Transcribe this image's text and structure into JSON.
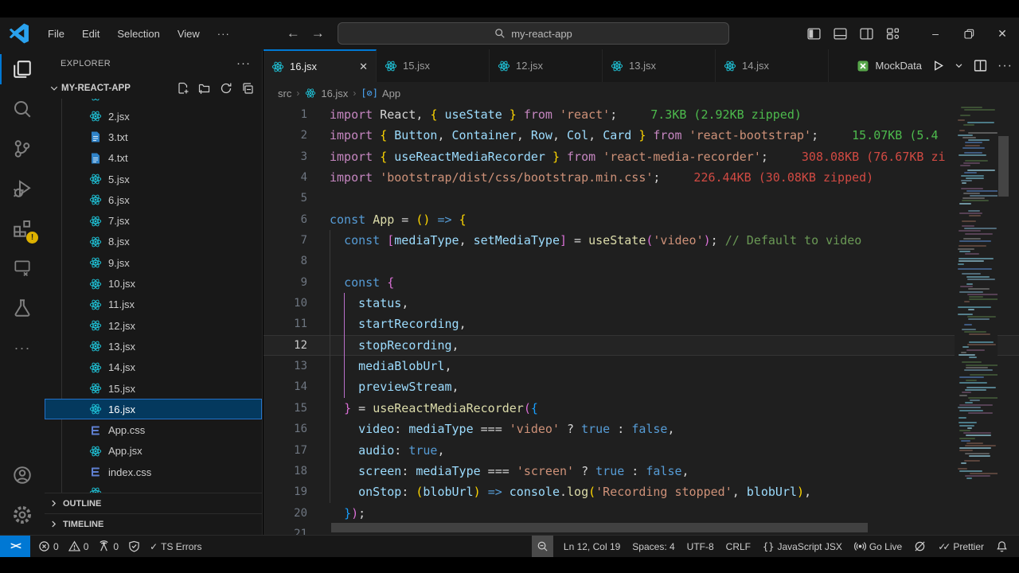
{
  "title_bar": {
    "menus": [
      "File",
      "Edit",
      "Selection",
      "View"
    ],
    "menu_more": "···",
    "search_value": "my-react-app"
  },
  "activity_bar": {
    "items": [
      {
        "icon": "files-icon",
        "active": true
      },
      {
        "icon": "search-icon"
      },
      {
        "icon": "source-control-icon"
      },
      {
        "icon": "run-debug-icon"
      },
      {
        "icon": "extensions-icon",
        "badge": "!"
      },
      {
        "icon": "remote-explorer-icon"
      },
      {
        "icon": "test-beaker-icon"
      },
      {
        "icon": "more-icon"
      }
    ],
    "bottom": [
      {
        "icon": "account-icon"
      },
      {
        "icon": "settings-gear-icon"
      }
    ]
  },
  "explorer": {
    "header": "EXPLORER",
    "header_more": "···",
    "section": "MY-REACT-APP",
    "files": [
      {
        "name": "2.jsx",
        "type": "jsx"
      },
      {
        "name": "3.txt",
        "type": "txt"
      },
      {
        "name": "4.txt",
        "type": "txt"
      },
      {
        "name": "5.jsx",
        "type": "jsx"
      },
      {
        "name": "6.jsx",
        "type": "jsx"
      },
      {
        "name": "7.jsx",
        "type": "jsx"
      },
      {
        "name": "8.jsx",
        "type": "jsx"
      },
      {
        "name": "9.jsx",
        "type": "jsx"
      },
      {
        "name": "10.jsx",
        "type": "jsx"
      },
      {
        "name": "11.jsx",
        "type": "jsx"
      },
      {
        "name": "12.jsx",
        "type": "jsx"
      },
      {
        "name": "13.jsx",
        "type": "jsx"
      },
      {
        "name": "14.jsx",
        "type": "jsx"
      },
      {
        "name": "15.jsx",
        "type": "jsx"
      },
      {
        "name": "16.jsx",
        "type": "jsx",
        "selected": true
      },
      {
        "name": "App.css",
        "type": "css"
      },
      {
        "name": "App.jsx",
        "type": "jsx"
      },
      {
        "name": "index.css",
        "type": "css"
      }
    ],
    "panels": [
      "OUTLINE",
      "TIMELINE"
    ]
  },
  "tabs": [
    {
      "label": "16.jsx",
      "active": true
    },
    {
      "label": "15.jsx"
    },
    {
      "label": "12.jsx"
    },
    {
      "label": "13.jsx"
    },
    {
      "label": "14.jsx"
    }
  ],
  "editor_actions": {
    "run_config": "MockData"
  },
  "breadcrumb": {
    "folder": "src",
    "file": "16.jsx",
    "symbol": "App"
  },
  "code": {
    "lines": [
      {
        "num": 1,
        "tokens": [
          [
            "kw",
            "import"
          ],
          [
            "pun",
            " "
          ],
          [
            "pun",
            "React"
          ],
          [
            "pun",
            ", "
          ],
          [
            "b1",
            "{"
          ],
          [
            "var",
            " useState "
          ],
          [
            "b1",
            "}"
          ],
          [
            "pun",
            " "
          ],
          [
            "kw",
            "from"
          ],
          [
            "pun",
            " "
          ],
          [
            "str",
            "'react'"
          ],
          [
            "pun",
            ";"
          ]
        ],
        "annotation": {
          "text": "7.3KB (2.92KB zipped)",
          "kind": "ok"
        }
      },
      {
        "num": 2,
        "tokens": [
          [
            "kw",
            "import"
          ],
          [
            "pun",
            " "
          ],
          [
            "b1",
            "{"
          ],
          [
            "var",
            " Button"
          ],
          [
            "pun",
            ", "
          ],
          [
            "var",
            "Container"
          ],
          [
            "pun",
            ", "
          ],
          [
            "var",
            "Row"
          ],
          [
            "pun",
            ", "
          ],
          [
            "var",
            "Col"
          ],
          [
            "pun",
            ", "
          ],
          [
            "var",
            "Card"
          ],
          [
            "pun",
            " "
          ],
          [
            "b1",
            "}"
          ],
          [
            "pun",
            " "
          ],
          [
            "kw",
            "from"
          ],
          [
            "pun",
            " "
          ],
          [
            "str",
            "'react-bootstrap'"
          ],
          [
            "pun",
            ";"
          ]
        ],
        "annotation": {
          "text": "15.07KB (5.4",
          "kind": "ok"
        }
      },
      {
        "num": 3,
        "tokens": [
          [
            "kw",
            "import"
          ],
          [
            "pun",
            " "
          ],
          [
            "b1",
            "{"
          ],
          [
            "var",
            " useReactMediaRecorder "
          ],
          [
            "b1",
            "}"
          ],
          [
            "pun",
            " "
          ],
          [
            "kw",
            "from"
          ],
          [
            "pun",
            " "
          ],
          [
            "str",
            "'react-media-recorder'"
          ],
          [
            "pun",
            ";"
          ]
        ],
        "annotation": {
          "text": "308.08KB (76.67KB zi",
          "kind": "err"
        }
      },
      {
        "num": 4,
        "tokens": [
          [
            "kw",
            "import"
          ],
          [
            "pun",
            " "
          ],
          [
            "str",
            "'bootstrap/dist/css/bootstrap.min.css'"
          ],
          [
            "pun",
            ";"
          ]
        ],
        "annotation": {
          "text": "226.44KB (30.08KB zipped)",
          "kind": "err"
        }
      },
      {
        "num": 5,
        "tokens": []
      },
      {
        "num": 6,
        "tokens": [
          [
            "kw2",
            "const"
          ],
          [
            "pun",
            " "
          ],
          [
            "fn",
            "App"
          ],
          [
            "pun",
            " = "
          ],
          [
            "b1",
            "()"
          ],
          [
            "pun",
            " "
          ],
          [
            "kw2",
            "=>"
          ],
          [
            "pun",
            " "
          ],
          [
            "b1",
            "{"
          ]
        ]
      },
      {
        "num": 7,
        "tokens": [
          [
            "pun",
            "  "
          ],
          [
            "kw2",
            "const"
          ],
          [
            "pun",
            " "
          ],
          [
            "b2",
            "["
          ],
          [
            "var",
            "mediaType"
          ],
          [
            "pun",
            ", "
          ],
          [
            "var",
            "setMediaType"
          ],
          [
            "b2",
            "]"
          ],
          [
            "pun",
            " = "
          ],
          [
            "fn",
            "useState"
          ],
          [
            "b2",
            "("
          ],
          [
            "str",
            "'video'"
          ],
          [
            "b2",
            ")"
          ],
          [
            "pun",
            "; "
          ],
          [
            "cm",
            "// Default to video"
          ]
        ]
      },
      {
        "num": 8,
        "tokens": []
      },
      {
        "num": 9,
        "tokens": [
          [
            "pun",
            "  "
          ],
          [
            "kw2",
            "const"
          ],
          [
            "pun",
            " "
          ],
          [
            "b2",
            "{"
          ]
        ]
      },
      {
        "num": 10,
        "tokens": [
          [
            "pun",
            "    "
          ],
          [
            "var",
            "status"
          ],
          [
            "pun",
            ","
          ]
        ]
      },
      {
        "num": 11,
        "tokens": [
          [
            "pun",
            "    "
          ],
          [
            "var",
            "startRecording"
          ],
          [
            "pun",
            ","
          ]
        ]
      },
      {
        "num": 12,
        "current": true,
        "tokens": [
          [
            "pun",
            "    "
          ],
          [
            "var",
            "stopRecording"
          ],
          [
            "pun",
            ","
          ]
        ]
      },
      {
        "num": 13,
        "tokens": [
          [
            "pun",
            "    "
          ],
          [
            "var",
            "mediaBlobUrl"
          ],
          [
            "pun",
            ","
          ]
        ]
      },
      {
        "num": 14,
        "tokens": [
          [
            "pun",
            "    "
          ],
          [
            "var",
            "previewStream"
          ],
          [
            "pun",
            ","
          ]
        ]
      },
      {
        "num": 15,
        "tokens": [
          [
            "pun",
            "  "
          ],
          [
            "b2",
            "}"
          ],
          [
            "pun",
            " = "
          ],
          [
            "fn",
            "useReactMediaRecorder"
          ],
          [
            "b2",
            "("
          ],
          [
            "b3",
            "{"
          ]
        ]
      },
      {
        "num": 16,
        "tokens": [
          [
            "pun",
            "    "
          ],
          [
            "var",
            "video"
          ],
          [
            "pun",
            ": "
          ],
          [
            "var",
            "mediaType"
          ],
          [
            "pun",
            " === "
          ],
          [
            "str",
            "'video'"
          ],
          [
            "pun",
            " ? "
          ],
          [
            "kw2",
            "true"
          ],
          [
            "pun",
            " : "
          ],
          [
            "kw2",
            "false"
          ],
          [
            "pun",
            ","
          ]
        ]
      },
      {
        "num": 17,
        "tokens": [
          [
            "pun",
            "    "
          ],
          [
            "var",
            "audio"
          ],
          [
            "pun",
            ": "
          ],
          [
            "kw2",
            "true"
          ],
          [
            "pun",
            ","
          ]
        ]
      },
      {
        "num": 18,
        "tokens": [
          [
            "pun",
            "    "
          ],
          [
            "var",
            "screen"
          ],
          [
            "pun",
            ": "
          ],
          [
            "var",
            "mediaType"
          ],
          [
            "pun",
            " === "
          ],
          [
            "str",
            "'screen'"
          ],
          [
            "pun",
            " ? "
          ],
          [
            "kw2",
            "true"
          ],
          [
            "pun",
            " : "
          ],
          [
            "kw2",
            "false"
          ],
          [
            "pun",
            ","
          ]
        ]
      },
      {
        "num": 19,
        "tokens": [
          [
            "pun",
            "    "
          ],
          [
            "var",
            "onStop"
          ],
          [
            "pun",
            ": "
          ],
          [
            "b1",
            "("
          ],
          [
            "var",
            "blobUrl"
          ],
          [
            "b1",
            ")"
          ],
          [
            "pun",
            " "
          ],
          [
            "kw2",
            "=>"
          ],
          [
            "pun",
            " "
          ],
          [
            "var",
            "console"
          ],
          [
            "pun",
            "."
          ],
          [
            "fn",
            "log"
          ],
          [
            "b1",
            "("
          ],
          [
            "str",
            "'Recording stopped'"
          ],
          [
            "pun",
            ", "
          ],
          [
            "var",
            "blobUrl"
          ],
          [
            "b1",
            ")"
          ],
          [
            "pun",
            ","
          ]
        ]
      },
      {
        "num": 20,
        "tokens": [
          [
            "pun",
            "  "
          ],
          [
            "b3",
            "}"
          ],
          [
            "b2",
            ")"
          ],
          [
            "pun",
            ";"
          ]
        ]
      },
      {
        "num": 21,
        "tokens": []
      }
    ]
  },
  "status_bar": {
    "left": [
      {
        "icon": "remote-icon",
        "name": "remote-indicator"
      },
      {
        "icon": "error-icon",
        "text": "0",
        "name": "errors-count"
      },
      {
        "icon": "warning-icon",
        "text": "0",
        "name": "warnings-count"
      },
      {
        "icon": "ports-icon",
        "text": "0",
        "name": "forwarded-ports"
      },
      {
        "icon": "shield-check-icon",
        "name": "trust-status"
      },
      {
        "icon": "check-icon",
        "text": "TS Errors",
        "name": "ts-errors-status"
      }
    ],
    "right": [
      {
        "icon": "zoom-icon",
        "highlight": true,
        "name": "zoom-indicator"
      },
      {
        "text": "Ln 12, Col 19",
        "name": "cursor-position"
      },
      {
        "text": "Spaces: 4",
        "name": "indentation"
      },
      {
        "text": "UTF-8",
        "name": "encoding"
      },
      {
        "text": "CRLF",
        "name": "eol-sequence"
      },
      {
        "icon": "braces-icon",
        "text": "JavaScript JSX",
        "name": "language-mode"
      },
      {
        "icon": "broadcast-icon",
        "text": "Go Live",
        "name": "go-live"
      },
      {
        "icon": "eslint-disabled-icon",
        "name": "eslint-status"
      },
      {
        "icon": "double-check-icon",
        "text": "Prettier",
        "name": "prettier-status"
      },
      {
        "icon": "bell-icon",
        "name": "notifications"
      }
    ]
  }
}
